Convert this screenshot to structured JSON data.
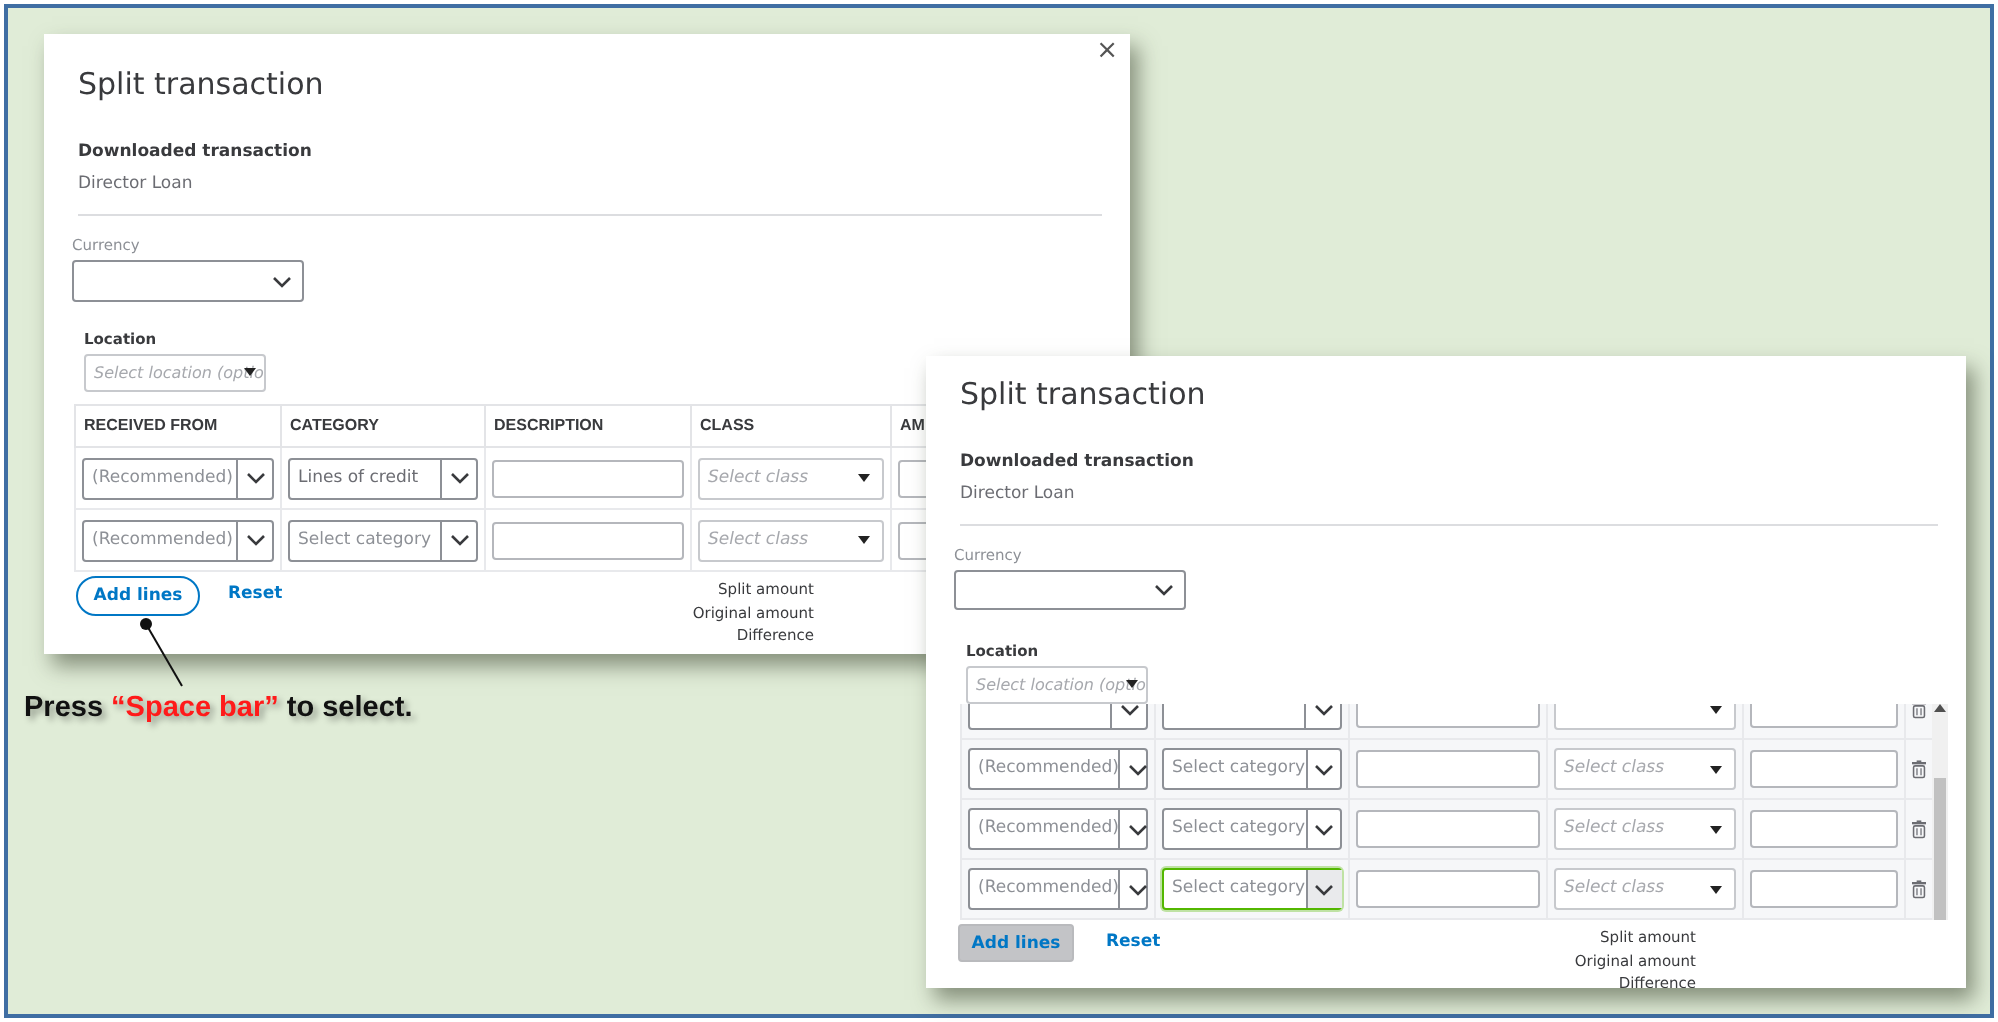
{
  "dialogs": [
    {
      "title": "Split transaction",
      "close": "×",
      "downloaded_label": "Downloaded transaction",
      "downloaded_value": "Director Loan",
      "currency_label": "Currency",
      "location_label": "Location",
      "location_placeholder": "Select location (optio",
      "columns": [
        "RECEIVED FROM",
        "CATEGORY",
        "DESCRIPTION",
        "CLASS",
        "AM"
      ],
      "rows": [
        {
          "kind": "full",
          "received_from": "(Recommended)",
          "category": "Lines of credit",
          "class_placeholder": "Select class",
          "focused": false
        },
        {
          "kind": "full",
          "received_from": "(Recommended)",
          "category_placeholder": "Select category",
          "class_placeholder": "Select class",
          "focused": false
        }
      ],
      "add_lines": {
        "label": "Add lines",
        "focused": true,
        "pressed": false
      },
      "reset": "Reset",
      "summary": [
        "Split amount",
        "Original amount",
        "Difference"
      ]
    },
    {
      "title": "Split transaction",
      "downloaded_label": "Downloaded transaction",
      "downloaded_value": "Director Loan",
      "currency_label": "Currency",
      "location_label": "Location",
      "location_placeholder": "Select location (optio",
      "show_delete": true,
      "scrollable": true,
      "rows": [
        {
          "kind": "clipped"
        },
        {
          "kind": "full",
          "received_from": "(Recommended)",
          "category_placeholder": "Select category",
          "class_placeholder": "Select class",
          "focused": false
        },
        {
          "kind": "full",
          "received_from": "(Recommended)",
          "category_placeholder": "Select category",
          "class_placeholder": "Select class",
          "focused": false
        },
        {
          "kind": "full",
          "received_from": "(Recommended)",
          "category_placeholder": "Select category",
          "class_placeholder": "Select class",
          "focused": true
        }
      ],
      "add_lines": {
        "label": "Add lines",
        "focused": false,
        "pressed": true
      },
      "reset": "Reset",
      "summary": [
        "Split amount",
        "Original amount",
        "Difference"
      ]
    }
  ],
  "callout": {
    "parts": [
      {
        "text": "Press",
        "kind": "plain"
      },
      {
        "text": "“Space bar”",
        "kind": "highlight"
      },
      {
        "text": "to select.",
        "kind": "plain"
      }
    ]
  }
}
